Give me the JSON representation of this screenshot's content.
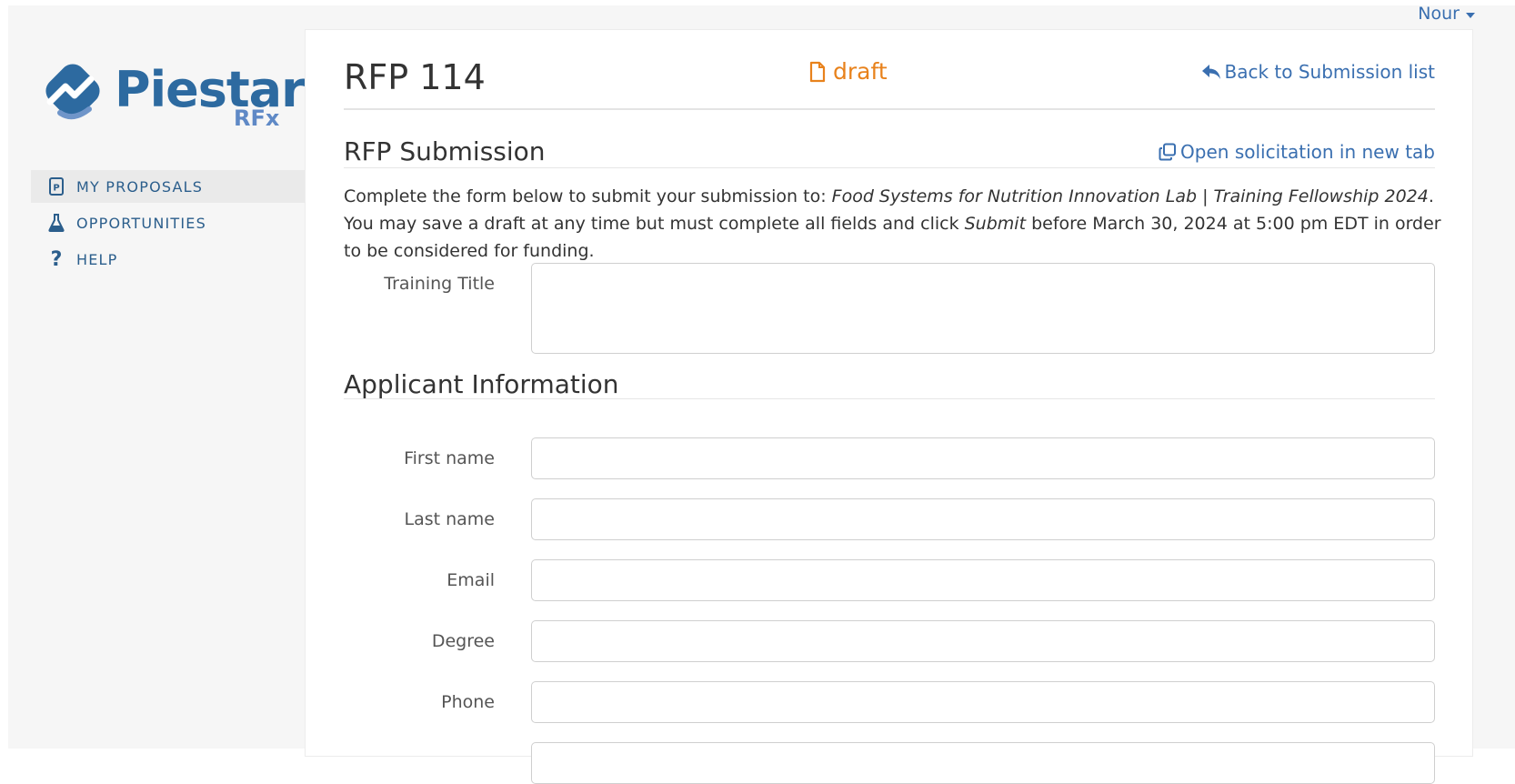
{
  "user": {
    "name": "Nour"
  },
  "brand": {
    "name": "Piestar",
    "sub": "RFx"
  },
  "sidebar": {
    "items": [
      {
        "label": "MY PROPOSALS",
        "icon": "proposal-doc-icon",
        "active": true
      },
      {
        "label": "OPPORTUNITIES",
        "icon": "flask-icon",
        "active": false
      },
      {
        "label": "HELP",
        "icon": "question-icon",
        "active": false
      }
    ]
  },
  "header": {
    "title": "RFP 114",
    "status": "draft",
    "back_link": "Back to Submission list"
  },
  "submission": {
    "heading": "RFP Submission",
    "open_link": "Open solicitation in new tab",
    "intro_1": "Complete the form below to submit your submission to: ",
    "intro_program": "Food Systems for Nutrition Innovation Lab | Training Fellowship 2024",
    "intro_2": ". You may save a draft at any time but must complete all fields and click ",
    "intro_submit": "Submit",
    "intro_3": " before March 30, 2024 at 5:00 pm EDT in order to be considered for funding.",
    "training_title_label": "Training Title",
    "training_title_value": ""
  },
  "applicant": {
    "heading": "Applicant Information",
    "fields": [
      {
        "label": "First name",
        "value": ""
      },
      {
        "label": "Last name",
        "value": ""
      },
      {
        "label": "Email",
        "value": ""
      },
      {
        "label": "Degree",
        "value": ""
      },
      {
        "label": "Phone",
        "value": ""
      }
    ]
  },
  "colors": {
    "accent": "#3a6fb0",
    "nav_text": "#2b5e8c",
    "draft": "#e8821c",
    "brand": "#2d6aa0"
  }
}
